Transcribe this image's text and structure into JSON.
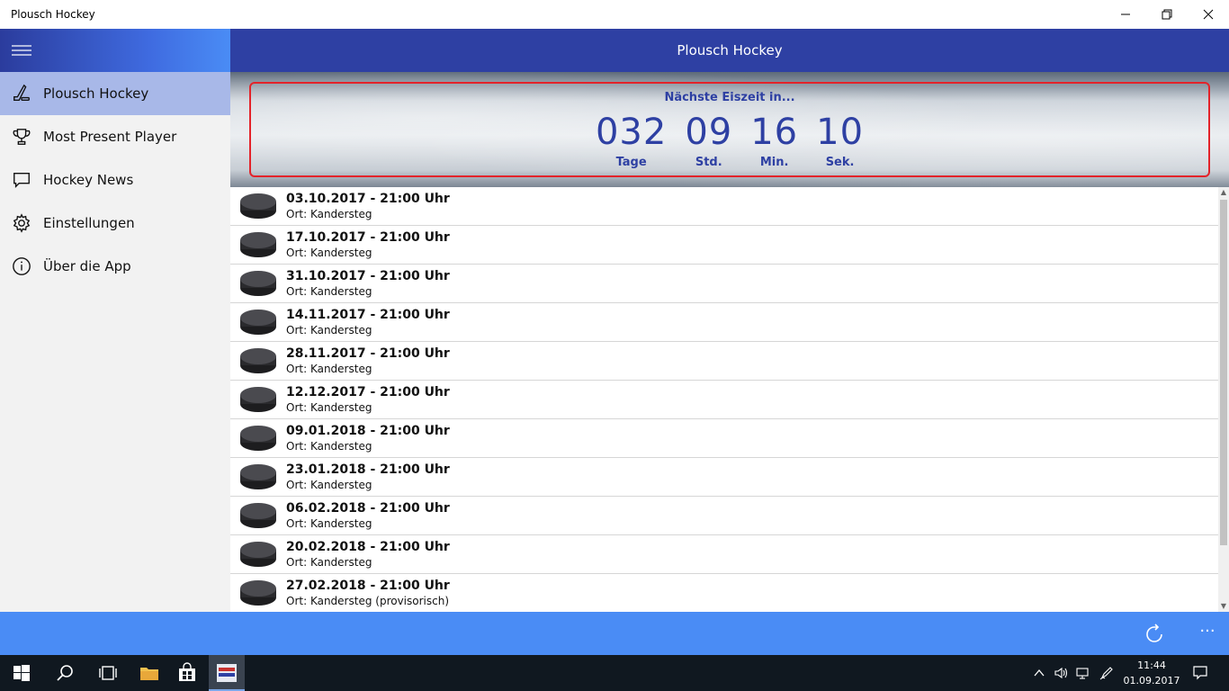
{
  "window": {
    "title": "Plousch Hockey"
  },
  "sidebar": {
    "items": [
      {
        "label": "Plousch Hockey",
        "icon": "hockey-stick-icon",
        "active": true
      },
      {
        "label": "Most Present Player",
        "icon": "trophy-icon",
        "active": false
      },
      {
        "label": "Hockey News",
        "icon": "chat-bubble-icon",
        "active": false
      },
      {
        "label": "Einstellungen",
        "icon": "gear-icon",
        "active": false
      },
      {
        "label": "Über die App",
        "icon": "info-icon",
        "active": false
      }
    ]
  },
  "header": {
    "title": "Plousch Hockey"
  },
  "countdown": {
    "heading": "Nächste Eiszeit in...",
    "days": {
      "value": "032",
      "label": "Tage"
    },
    "hours": {
      "value": "09",
      "label": "Std."
    },
    "minutes": {
      "value": "16",
      "label": "Min."
    },
    "seconds": {
      "value": "10",
      "label": "Sek."
    }
  },
  "events": [
    {
      "date": "03.10.2017 - 21:00 Uhr",
      "location": "Ort: Kandersteg"
    },
    {
      "date": "17.10.2017 - 21:00 Uhr",
      "location": "Ort: Kandersteg"
    },
    {
      "date": "31.10.2017 - 21:00 Uhr",
      "location": "Ort: Kandersteg"
    },
    {
      "date": "14.11.2017 - 21:00 Uhr",
      "location": "Ort: Kandersteg"
    },
    {
      "date": "28.11.2017 - 21:00 Uhr",
      "location": "Ort: Kandersteg"
    },
    {
      "date": "12.12.2017 - 21:00 Uhr",
      "location": "Ort: Kandersteg"
    },
    {
      "date": "09.01.2018 - 21:00 Uhr",
      "location": "Ort: Kandersteg"
    },
    {
      "date": "23.01.2018 - 21:00 Uhr",
      "location": "Ort: Kandersteg"
    },
    {
      "date": "06.02.2018 - 21:00 Uhr",
      "location": "Ort: Kandersteg"
    },
    {
      "date": "20.02.2018 - 21:00 Uhr",
      "location": "Ort: Kandersteg"
    },
    {
      "date": "27.02.2018 - 21:00 Uhr",
      "location": "Ort: Kandersteg (provisorisch)"
    }
  ],
  "commandbar": {
    "more": "···"
  },
  "taskbar": {
    "time": "11:44",
    "date": "01.09.2017"
  },
  "colors": {
    "header": "#2e40a3",
    "accent": "#4a8cf5",
    "active_nav": "#a8b8e8",
    "countdown_border": "#e3232a"
  }
}
